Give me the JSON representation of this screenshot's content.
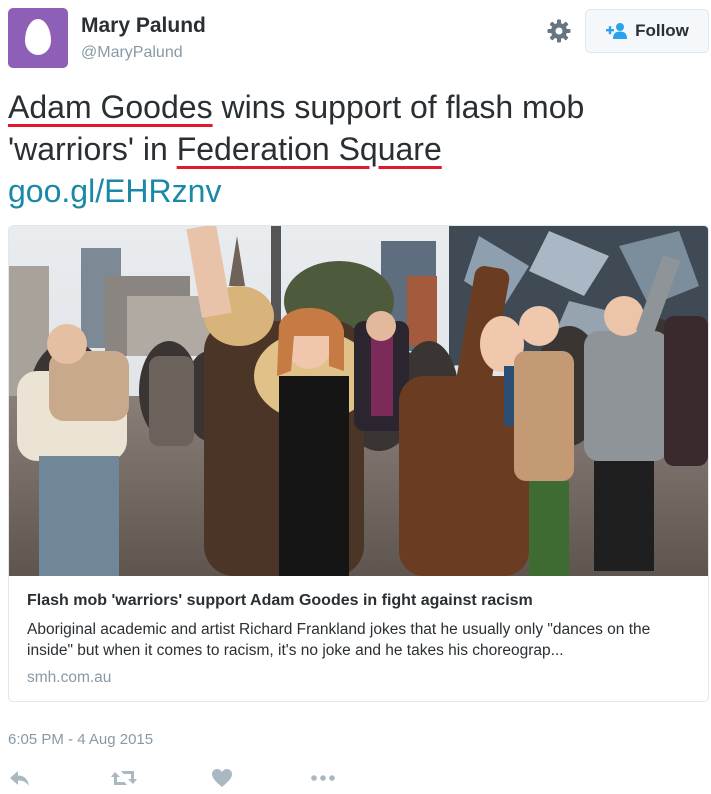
{
  "user": {
    "display_name": "Mary Palund",
    "handle": "@MaryPalund"
  },
  "header": {
    "follow_label": "Follow",
    "settings_icon": "gear-icon",
    "follow_icon": "add-user-icon"
  },
  "tweet": {
    "part1_underlined": "Adam Goodes",
    "part2": " wins support of flash mob 'warriors' in ",
    "part3_underlined": "Federation Square",
    "link": "goo.gl/EHRznv",
    "underline_color": "#e0192e",
    "link_color": "#1b88a8"
  },
  "card": {
    "title": "Flash mob 'warriors' support Adam Goodes in fight against racism",
    "description": "Aboriginal academic and artist Richard Frankland jokes that he usually only \"dances on the inside\" but when it comes to racism, it's no joke and he takes his choreograp...",
    "domain": "smh.com.au"
  },
  "meta": {
    "timestamp": "6:05 PM - 4 Aug 2015"
  },
  "actions": [
    {
      "name": "reply-icon"
    },
    {
      "name": "retweet-icon"
    },
    {
      "name": "like-icon"
    },
    {
      "name": "more-icon"
    }
  ]
}
